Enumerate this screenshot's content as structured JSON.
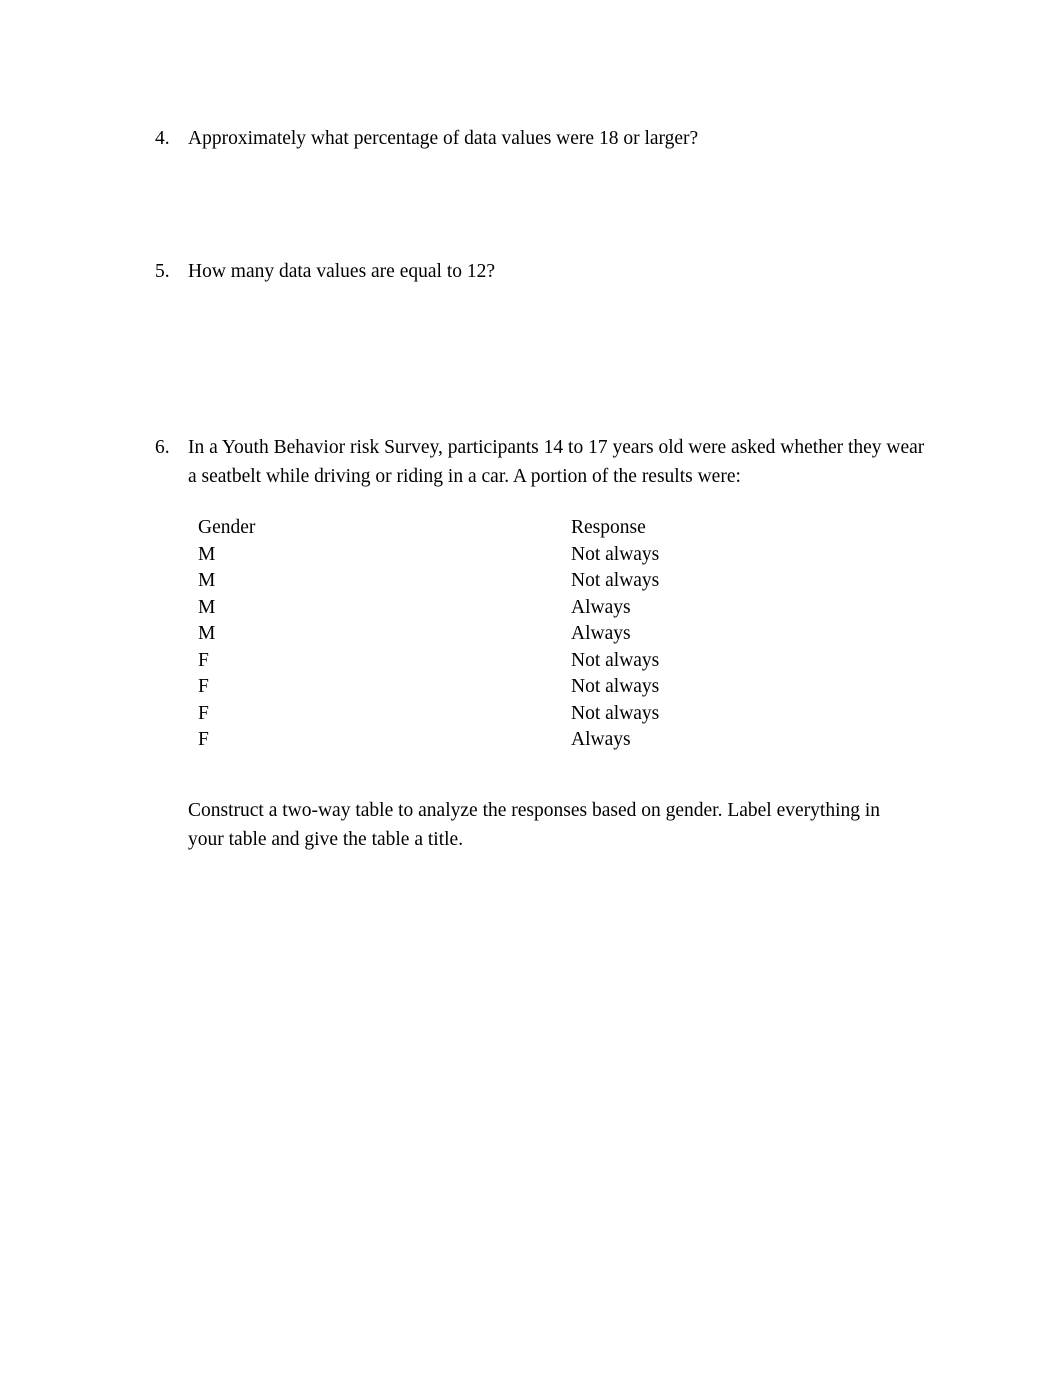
{
  "document": {
    "background_color": "#ffffff",
    "text_color": "#000000"
  },
  "questions": [
    {
      "number": "4.",
      "text": "Approximately what percentage of data values were 18 or larger?"
    },
    {
      "number": "5.",
      "text": "How many data values are equal to 12?"
    },
    {
      "number": "6.",
      "text": "In a Youth Behavior risk Survey, participants 14 to 17 years old were asked whether they wear a seatbelt while driving or riding in a car. A portion of the results were:"
    }
  ],
  "survey_table": {
    "headers": {
      "gender": "Gender",
      "response": "Response"
    },
    "rows": [
      {
        "gender": "M",
        "response": "Not always"
      },
      {
        "gender": "M",
        "response": "Not always"
      },
      {
        "gender": "M",
        "response": "Always"
      },
      {
        "gender": "M",
        "response": "Always"
      },
      {
        "gender": "F",
        "response": "Not always"
      },
      {
        "gender": "F",
        "response": "Not always"
      },
      {
        "gender": "F",
        "response": "Not always"
      },
      {
        "gender": "F",
        "response": "Always"
      }
    ]
  },
  "closing_instruction": {
    "text": "Construct a two-way table to analyze the responses based on gender. Label everything in your table and give the table a title."
  }
}
